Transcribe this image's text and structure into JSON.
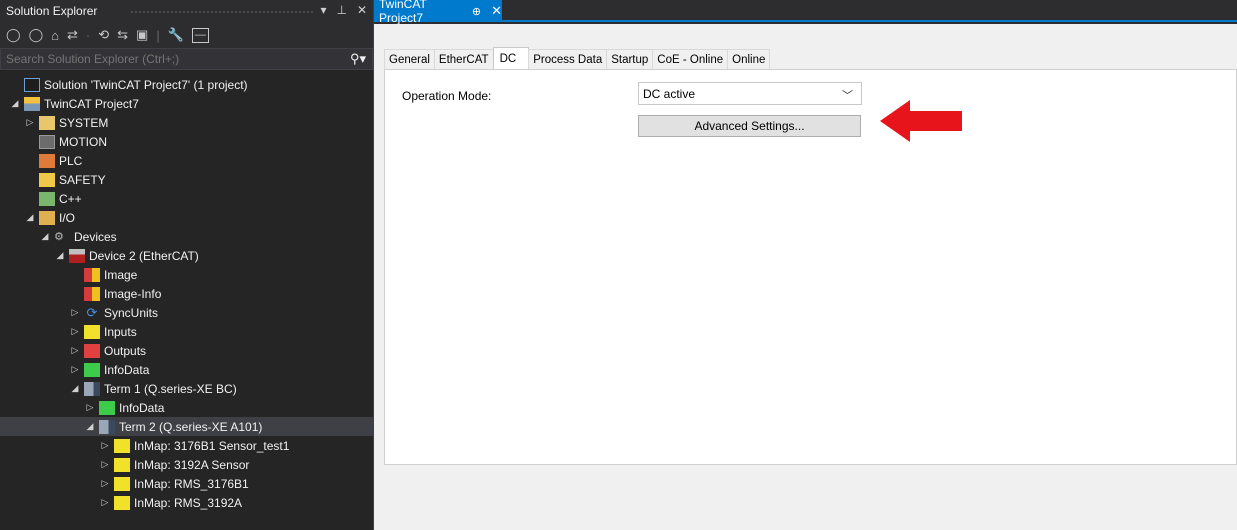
{
  "solution_explorer": {
    "title": "Solution Explorer",
    "title_controls": [
      "▾",
      "⊥",
      "✕"
    ],
    "toolbar_icons": [
      "back-icon",
      "forward-icon",
      "home-icon",
      "sync-icon",
      "history-icon",
      "collapse-icon",
      "properties-icon",
      "wrench-icon",
      "preview-icon"
    ],
    "search_placeholder": "Search Solution Explorer (Ctrl+;)",
    "tree": [
      {
        "label": "Solution 'TwinCAT Project7' (1 project)",
        "indent": 0,
        "twisty": "",
        "icon": "solution-icon"
      },
      {
        "label": "TwinCAT Project7",
        "indent": 0,
        "twisty": "◢",
        "icon": "project-icon"
      },
      {
        "label": "SYSTEM",
        "indent": 1,
        "twisty": "▷",
        "icon": "system-icon"
      },
      {
        "label": "MOTION",
        "indent": 1,
        "twisty": "",
        "icon": "motion-icon"
      },
      {
        "label": "PLC",
        "indent": 1,
        "twisty": "",
        "icon": "plc-icon"
      },
      {
        "label": "SAFETY",
        "indent": 1,
        "twisty": "",
        "icon": "safety-icon"
      },
      {
        "label": "C++",
        "indent": 1,
        "twisty": "",
        "icon": "cpp-icon"
      },
      {
        "label": "I/O",
        "indent": 1,
        "twisty": "◢",
        "icon": "io-icon"
      },
      {
        "label": "Devices",
        "indent": 2,
        "twisty": "◢",
        "icon": "devices-icon"
      },
      {
        "label": "Device 2 (EtherCAT)",
        "indent": 3,
        "twisty": "◢",
        "icon": "device-icon"
      },
      {
        "label": "Image",
        "indent": 4,
        "twisty": "",
        "icon": "image-icon"
      },
      {
        "label": "Image-Info",
        "indent": 4,
        "twisty": "",
        "icon": "image-icon"
      },
      {
        "label": "SyncUnits",
        "indent": 4,
        "twisty": "▷",
        "icon": "syncunits-icon"
      },
      {
        "label": "Inputs",
        "indent": 4,
        "twisty": "▷",
        "icon": "inputs-icon"
      },
      {
        "label": "Outputs",
        "indent": 4,
        "twisty": "▷",
        "icon": "outputs-icon"
      },
      {
        "label": "InfoData",
        "indent": 4,
        "twisty": "▷",
        "icon": "infodata-icon"
      },
      {
        "label": "Term 1 (Q.series-XE BC)",
        "indent": 4,
        "twisty": "◢",
        "icon": "terminal-icon"
      },
      {
        "label": "InfoData",
        "indent": 5,
        "twisty": "▷",
        "icon": "infodata-icon"
      },
      {
        "label": "Term 2 (Q.series-XE A101)",
        "indent": 5,
        "twisty": "◢",
        "icon": "terminal-icon",
        "selected": true
      },
      {
        "label": "InMap: 3176B1 Sensor_test1",
        "indent": 6,
        "twisty": "▷",
        "icon": "inputs-icon"
      },
      {
        "label": "InMap: 3192A Sensor",
        "indent": 6,
        "twisty": "▷",
        "icon": "inputs-icon"
      },
      {
        "label": "InMap: RMS_3176B1",
        "indent": 6,
        "twisty": "▷",
        "icon": "inputs-icon"
      },
      {
        "label": "InMap: RMS_3192A",
        "indent": 6,
        "twisty": "▷",
        "icon": "inputs-icon"
      }
    ]
  },
  "document": {
    "tab_title": "TwinCAT Project7",
    "tab_pin": "⊕",
    "tab_close": "✕",
    "tabs": [
      {
        "label": "General",
        "active": false
      },
      {
        "label": "EtherCAT",
        "active": false
      },
      {
        "label": "DC",
        "active": true
      },
      {
        "label": "Process Data",
        "active": false
      },
      {
        "label": "Startup",
        "active": false
      },
      {
        "label": "CoE - Online",
        "active": false
      },
      {
        "label": "Online",
        "active": false
      }
    ],
    "operation_mode_label": "Operation Mode:",
    "operation_mode_value": "DC active",
    "advanced_settings_label": "Advanced Settings...",
    "arrow_color": "#e8141c"
  }
}
